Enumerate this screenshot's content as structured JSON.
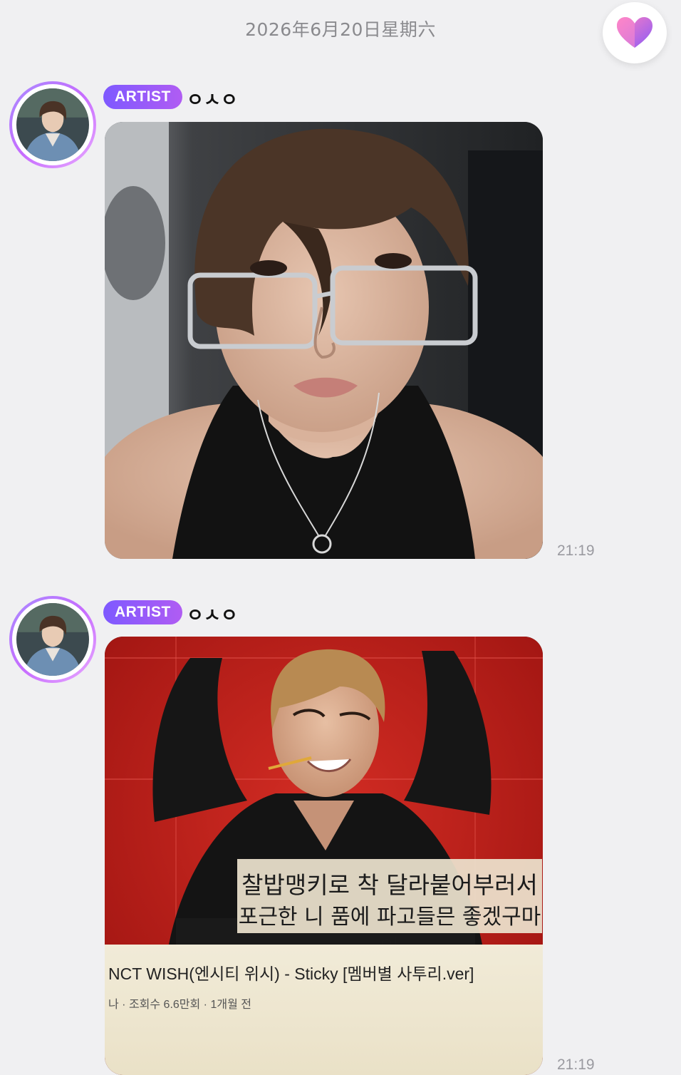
{
  "header": {
    "date": "2026年6月20日星期六"
  },
  "fab": {
    "icon": "heart-icon",
    "colors": [
      "#ff7fc2",
      "#8b5cf6"
    ]
  },
  "messages": [
    {
      "badge": "ARTIST",
      "name": "ㅇㅅㅇ",
      "attachment": "photo",
      "timestamp": "21:19"
    },
    {
      "badge": "ARTIST",
      "name": "ㅇㅅㅇ",
      "attachment": "video-screenshot",
      "caption_line1": "찰밥맹키로 착 달라붙어부러서",
      "caption_line2": "포근한 니 품에 파고들믄 좋겠구마잉",
      "video_title": "NCT WISH(엔시티 위시) - Sticky [멤버별 사투리.ver]",
      "video_sub": "나 · 조회수 6.6만회 · 1개월 전",
      "timestamp": "21:19"
    }
  ],
  "colors": {
    "background": "#f0f0f2",
    "badge_start": "#7e59ff",
    "badge_end": "#b05cf3",
    "timestamp": "#9a9aa0"
  }
}
